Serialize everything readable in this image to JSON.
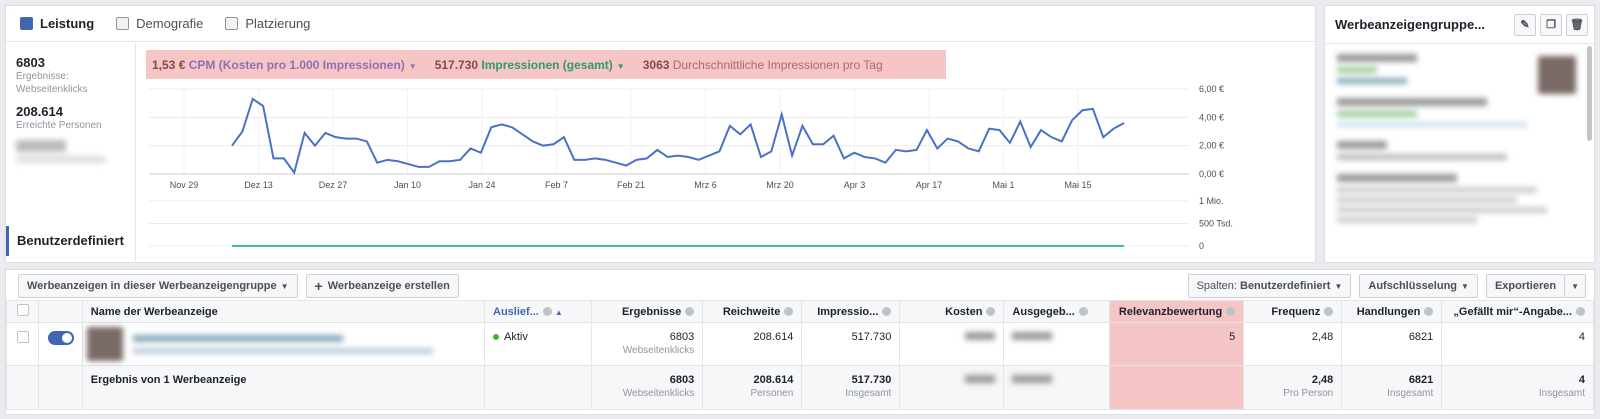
{
  "tabs": [
    {
      "label": "Leistung"
    },
    {
      "label": "Demografie"
    },
    {
      "label": "Platzierung"
    }
  ],
  "metrics": [
    {
      "value": "6803",
      "label": "Ergebnisse: Webseitenklicks"
    },
    {
      "value": "208.614",
      "label": "Erreichte Personen"
    }
  ],
  "custom_label": "Benutzerdefiniert",
  "metric_bar": {
    "m1_value": "1,53 €",
    "m1_label": "CPM (Kosten pro 1.000 Impressionen)",
    "m2_value": "517.730",
    "m2_label": "Impressionen (gesamt)",
    "m3_value": "3063",
    "m3_label": "Durchschnittliche Impressionen pro Tag"
  },
  "chart_data": [
    {
      "type": "line",
      "title": "",
      "series": [
        {
          "name": "CPM (Kosten pro 1.000 Impressionen)",
          "color": "#4a72c4",
          "values": [
            2.0,
            3.0,
            5.3,
            4.8,
            1.1,
            1.1,
            0.1,
            2.9,
            2.0,
            2.9,
            2.6,
            2.5,
            2.5,
            2.3,
            0.8,
            1.0,
            0.9,
            0.7,
            0.5,
            0.5,
            0.9,
            0.9,
            1.0,
            1.8,
            1.5,
            3.3,
            3.5,
            3.3,
            2.8,
            2.3,
            2.0,
            2.1,
            2.6,
            1.0,
            1.0,
            1.1,
            1.0,
            0.8,
            0.6,
            1.0,
            1.1,
            1.7,
            1.2,
            1.3,
            1.2,
            1.0,
            1.3,
            1.6,
            3.4,
            2.8,
            3.5,
            1.2,
            1.6,
            4.2,
            1.3,
            3.4,
            2.1,
            2.1,
            2.7,
            1.1,
            1.5,
            1.2,
            1.1,
            0.8,
            1.7,
            1.6,
            1.7,
            3.1,
            1.8,
            2.5,
            2.3,
            1.8,
            1.6,
            3.2,
            3.1,
            2.2,
            3.7,
            1.9,
            3.1,
            2.6,
            2.3,
            3.8,
            4.5,
            4.6,
            2.6,
            3.2,
            3.6
          ]
        }
      ],
      "x_ticks": [
        "Nov 29",
        "Dez 13",
        "Dez 27",
        "Jan 10",
        "Jan 24",
        "Feb 7",
        "Feb 21",
        "Mrz 6",
        "Mrz 20",
        "Apr 3",
        "Apr 17",
        "Mai 1",
        "Mai 15"
      ],
      "y_ticks": [
        "6,00 €",
        "4,00 €",
        "2,00 €",
        "0,00 €"
      ],
      "ylim": [
        0,
        6
      ],
      "grid": true
    },
    {
      "type": "area",
      "title": "",
      "series": [
        {
          "name": "Impressionen (gesamt)",
          "color": "#3cc1a2",
          "values": [
            0,
            0.01,
            0.02,
            0.03,
            0.04,
            0.06,
            0.09,
            0.12,
            0.15,
            0.18,
            0.21,
            0.23,
            0.25,
            0.27,
            0.29,
            0.31,
            0.33,
            0.35,
            0.37,
            0.39,
            0.41,
            0.43,
            0.45,
            0.47,
            0.5,
            0.52,
            0.55,
            0.57,
            0.59,
            0.61,
            0.62,
            0.63,
            0.64,
            0.65,
            0.66,
            0.67,
            0.68,
            0.69,
            0.7,
            0.72
          ]
        }
      ],
      "y_ticks": [
        "1 Mio.",
        "500 Tsd.",
        "0"
      ],
      "ylim": [
        0,
        1000000
      ]
    }
  ],
  "right_panel": {
    "title": "Werbeanzeigengruppe...",
    "edit_icon": "pencil-icon",
    "dup_icon": "duplicate-icon",
    "delete_icon": "trash-icon"
  },
  "toolbar": {
    "filter_label": "Werbeanzeigen in dieser Werbeanzeigengruppe",
    "create_label": "Werbeanzeige erstellen",
    "columns_prefix": "Spalten:",
    "columns_value": "Benutzerdefiniert",
    "breakdown_label": "Aufschlüsselung",
    "export_label": "Exportieren"
  },
  "table": {
    "headers": {
      "name": "Name der Werbeanzeige",
      "delivery": "Auslief...",
      "results": "Ergebnisse",
      "reach": "Reichweite",
      "impr": "Impressio...",
      "cost": "Kosten",
      "spent": "Ausgegeb...",
      "relevance": "Relevanzbewertung",
      "freq": "Frequenz",
      "actions": "Handlungen",
      "likes": "„Gefällt mir“-Angabe..."
    },
    "row": {
      "delivery": "Aktiv",
      "results": "6803",
      "results_sub": "Webseitenklicks",
      "reach": "208.614",
      "impr": "517.730",
      "relevance": "5",
      "freq": "2,48",
      "actions": "6821",
      "likes": "4"
    },
    "summary": {
      "label": "Ergebnis von 1 Werbeanzeige",
      "results": "6803",
      "results_sub": "Webseitenklicks",
      "reach": "208.614",
      "reach_sub": "Personen",
      "impr": "517.730",
      "impr_sub": "Insgesamt",
      "freq": "2,48",
      "freq_sub": "Pro Person",
      "actions": "6821",
      "actions_sub": "Insgesamt",
      "likes": "4",
      "likes_sub": "Insgesamt"
    }
  }
}
